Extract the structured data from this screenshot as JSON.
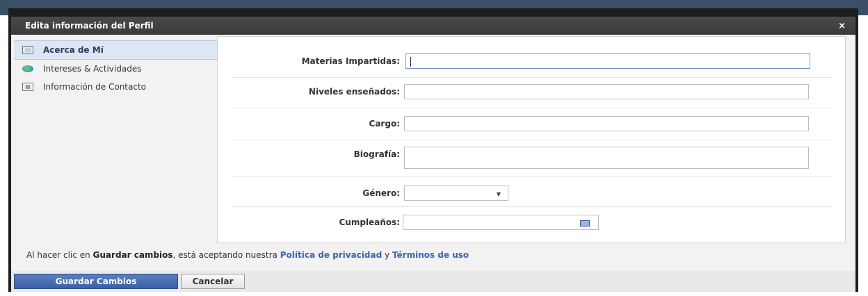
{
  "dialog": {
    "title": "Edita información del Perfil",
    "close": "×"
  },
  "sidebar": {
    "items": [
      {
        "label": "Acerca de Mí",
        "icon": "id-card-icon",
        "active": true
      },
      {
        "label": "Intereses & Actividades",
        "icon": "globe-icon",
        "active": false
      },
      {
        "label": "Información de Contacto",
        "icon": "address-book-icon",
        "active": false
      }
    ]
  },
  "form": {
    "materias_label": "Materias Impartidas:",
    "materias_value": "",
    "niveles_label": "Niveles enseñados:",
    "niveles_value": "",
    "cargo_label": "Cargo:",
    "cargo_value": "",
    "biografia_label": "Biografía:",
    "biografia_value": "",
    "genero_label": "Género:",
    "genero_value": "",
    "cumple_label": "Cumpleaños:",
    "cumple_value": ""
  },
  "notice": {
    "prefix": "Al hacer clic en ",
    "bold": "Guardar cambios",
    "middle": ", está aceptando nuestra ",
    "privacy_link": "Política de privacidad",
    "and": " y ",
    "terms_link": "Términos de uso"
  },
  "buttons": {
    "save": "Guardar Cambios",
    "cancel": "Cancelar"
  }
}
